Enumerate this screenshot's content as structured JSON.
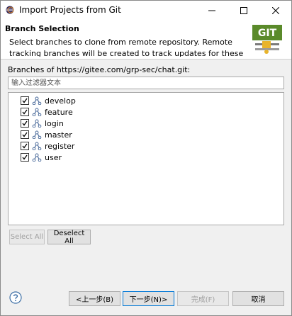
{
  "window": {
    "title": "Import Projects from Git"
  },
  "banner": {
    "title": "Branch Selection",
    "description": "Select branches to clone from remote repository. Remote tracking branches will be created to track updates for these branches in the",
    "logo_text": "GIT"
  },
  "branches": {
    "label": "Branches of https://gitee.com/grp-sec/chat.git:",
    "filter_placeholder": "输入过滤器文本",
    "items": [
      {
        "name": "develop",
        "checked": true
      },
      {
        "name": "feature",
        "checked": true
      },
      {
        "name": "login",
        "checked": true
      },
      {
        "name": "master",
        "checked": true
      },
      {
        "name": "register",
        "checked": true
      },
      {
        "name": "user",
        "checked": true
      }
    ]
  },
  "buttons": {
    "select_all": "Select All",
    "deselect_all": "Deselect All",
    "back": "<上一步(B)",
    "next": "下一步(N)>",
    "finish": "完成(F)",
    "cancel": "取消"
  },
  "icons": {
    "app": "eclipse-icon",
    "minimize": "minimize-icon",
    "maximize": "maximize-icon",
    "close": "close-icon",
    "branch": "git-branch-icon",
    "help": "help-icon"
  },
  "colors": {
    "window_bg": "#f0f0f0",
    "banner_bg": "#ffffff",
    "default_button_border": "#0078d7",
    "git_logo_bg": "#5a8a2a"
  }
}
